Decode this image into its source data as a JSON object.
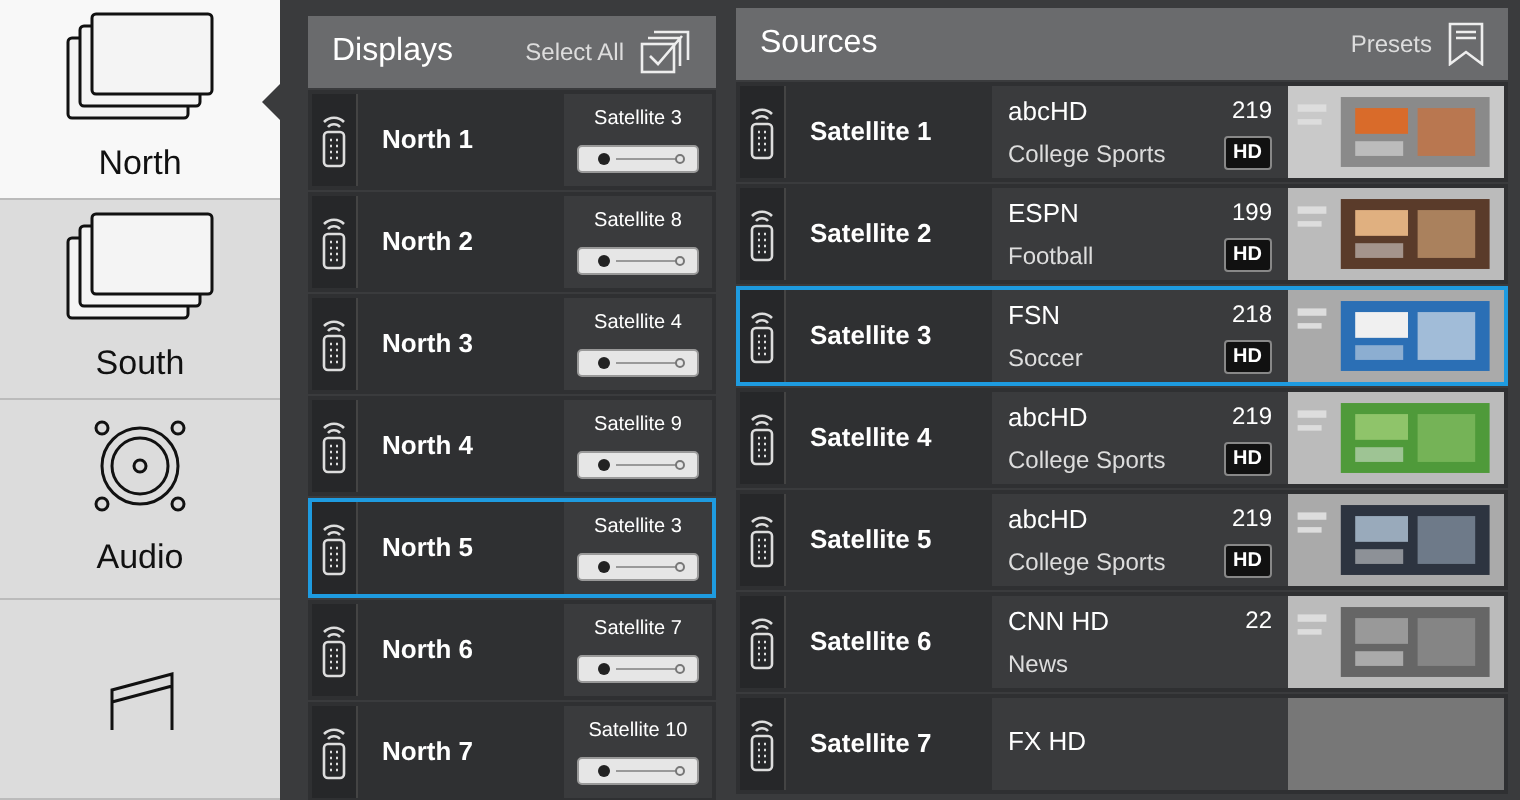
{
  "sidebar": {
    "items": [
      {
        "label": "North",
        "kind": "screens",
        "selected": true
      },
      {
        "label": "South",
        "kind": "screens",
        "selected": false
      },
      {
        "label": "Audio",
        "kind": "speaker",
        "selected": false
      },
      {
        "kind": "music",
        "selected": false
      }
    ]
  },
  "displays": {
    "title": "Displays",
    "select_all": "Select All",
    "rows": [
      {
        "name": "North 1",
        "source": "Satellite 3",
        "selected": false
      },
      {
        "name": "North 2",
        "source": "Satellite 8",
        "selected": false
      },
      {
        "name": "North 3",
        "source": "Satellite 4",
        "selected": false
      },
      {
        "name": "North 4",
        "source": "Satellite 9",
        "selected": false
      },
      {
        "name": "North 5",
        "source": "Satellite 3",
        "selected": true
      },
      {
        "name": "North 6",
        "source": "Satellite 7",
        "selected": false
      },
      {
        "name": "North 7",
        "source": "Satellite 10",
        "selected": false
      }
    ]
  },
  "sources": {
    "title": "Sources",
    "presets": "Presets",
    "rows": [
      {
        "name": "Satellite 1",
        "channel": "abcHD",
        "number": "219",
        "program": "College Sports",
        "badge": "HD",
        "thumbnail": true,
        "selected": false
      },
      {
        "name": "Satellite 2",
        "channel": "ESPN",
        "number": "199",
        "program": "Football",
        "badge": "HD",
        "thumbnail": true,
        "selected": false
      },
      {
        "name": "Satellite 3",
        "channel": "FSN",
        "number": "218",
        "program": "Soccer",
        "badge": "HD",
        "thumbnail": true,
        "selected": true
      },
      {
        "name": "Satellite 4",
        "channel": "abcHD",
        "number": "219",
        "program": "College Sports",
        "badge": "HD",
        "thumbnail": true,
        "selected": false
      },
      {
        "name": "Satellite 5",
        "channel": "abcHD",
        "number": "219",
        "program": "College Sports",
        "badge": "HD",
        "thumbnail": true,
        "selected": false
      },
      {
        "name": "Satellite 6",
        "channel": "CNN HD",
        "number": "22",
        "program": "News",
        "thumbnail": true,
        "selected": false
      },
      {
        "name": "Satellite 7",
        "channel": "FX HD",
        "selected": false
      }
    ]
  }
}
